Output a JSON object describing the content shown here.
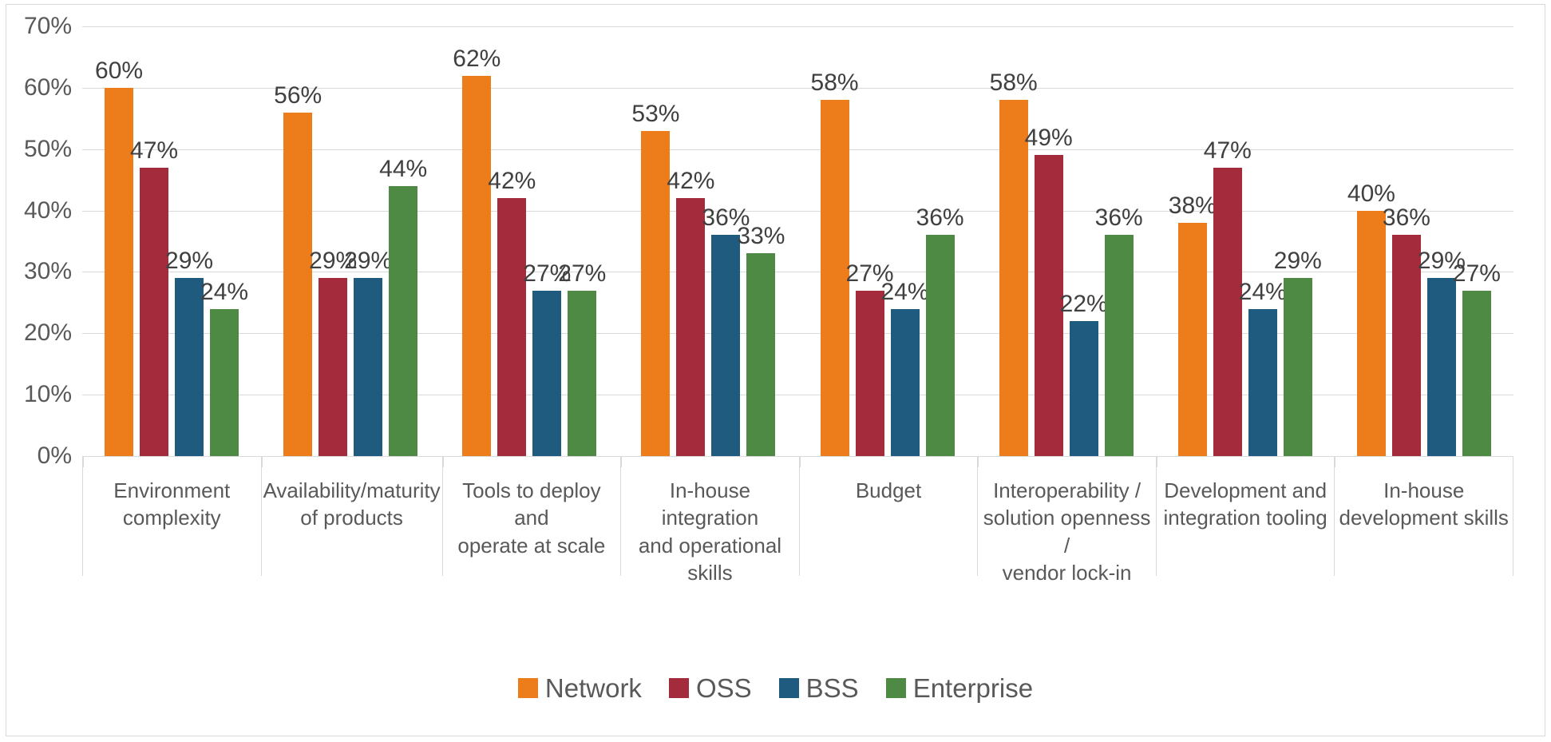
{
  "chart_data": {
    "type": "bar",
    "title": "",
    "subtitle": "",
    "xlabel": "",
    "ylabel": "",
    "ylim": [
      0,
      70
    ],
    "ytick_step": 10,
    "ytick_labels": [
      "70%",
      "60%",
      "50%",
      "40%",
      "30%",
      "20%",
      "10%",
      "0%"
    ],
    "ytick_values": [
      70,
      60,
      50,
      40,
      30,
      20,
      10,
      0
    ],
    "grid": true,
    "legend_position": "bottom",
    "value_label_suffix": "%",
    "categories": [
      "Environment complexity",
      "Availability/maturity of products",
      "Tools to deploy and operate at scale",
      "In-house integration and operational skills",
      "Budget",
      "Interoperability / solution openness / vendor lock-in",
      "Development and integration tooling",
      "In-house  development  skills"
    ],
    "category_lines": [
      [
        "Environment",
        "complexity"
      ],
      [
        "Availability/maturity",
        "of products"
      ],
      [
        "Tools to deploy and",
        "operate at scale"
      ],
      [
        "In-house integration",
        "and operational skills"
      ],
      [
        "Budget"
      ],
      [
        "Interoperability /",
        "solution openness /",
        "vendor lock-in"
      ],
      [
        "Development and",
        "integration tooling"
      ],
      [
        "In-house",
        "development  skills"
      ]
    ],
    "series": [
      {
        "name": "Network",
        "color": "#ED7D1B",
        "values": [
          60,
          56,
          62,
          53,
          58,
          58,
          38,
          40
        ],
        "labels": [
          "60%",
          "56%",
          "62%",
          "53%",
          "58%",
          "58%",
          "38%",
          "40%"
        ]
      },
      {
        "name": "OSS",
        "color": "#A32B3B",
        "values": [
          47,
          29,
          42,
          42,
          27,
          49,
          47,
          36
        ],
        "labels": [
          "47%",
          "29%",
          "42%",
          "42%",
          "27%",
          "49%",
          "47%",
          "36%"
        ]
      },
      {
        "name": "BSS",
        "color": "#1F5B7F",
        "values": [
          29,
          29,
          27,
          36,
          24,
          22,
          24,
          29
        ],
        "labels": [
          "29%",
          "29%",
          "27%",
          "36%",
          "24%",
          "22%",
          "24%",
          "29%"
        ]
      },
      {
        "name": "Enterprise",
        "color": "#4E8A43",
        "values": [
          24,
          44,
          27,
          33,
          36,
          36,
          29,
          27
        ],
        "labels": [
          "24%",
          "44%",
          "27%",
          "33%",
          "36%",
          "36%",
          "29%",
          "27%"
        ]
      }
    ]
  },
  "colors": {
    "network": "#ED7D1B",
    "oss": "#A32B3B",
    "bss": "#1F5B7F",
    "enterprise": "#4E8A43",
    "gridline": "#d9d9d9",
    "axis_text": "#595959",
    "data_label_text": "#404040",
    "frame": "#d9d9d9",
    "background": "#ffffff"
  }
}
